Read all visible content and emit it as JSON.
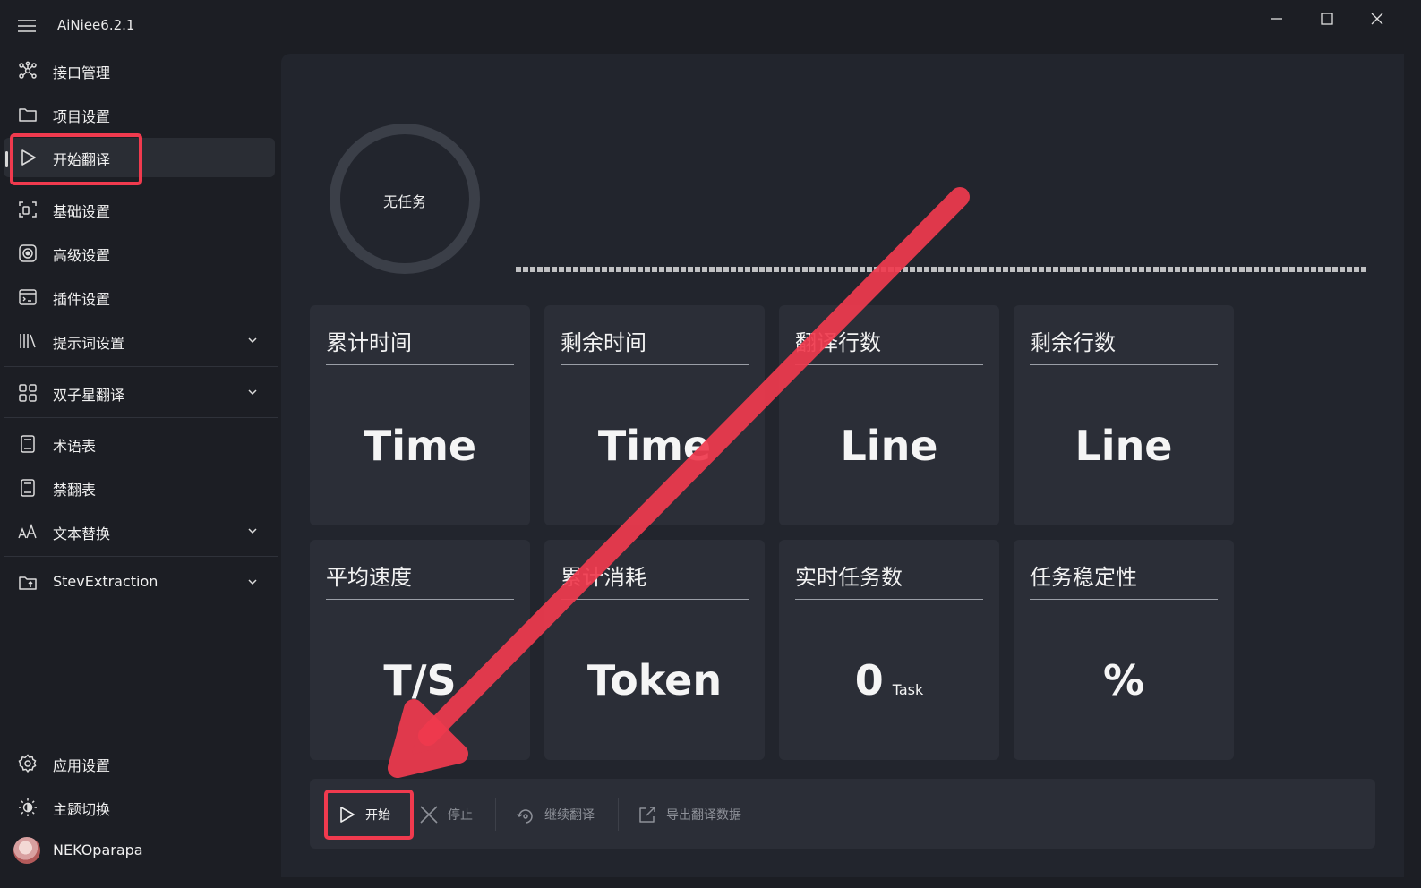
{
  "window": {
    "title": "AiNiee6.2.1"
  },
  "sidebar": {
    "items": [
      {
        "label": "接口管理"
      },
      {
        "label": "项目设置"
      },
      {
        "label": "开始翻译"
      },
      {
        "label": "基础设置"
      },
      {
        "label": "高级设置"
      },
      {
        "label": "插件设置"
      },
      {
        "label": "提示词设置"
      },
      {
        "label": "双子星翻译"
      },
      {
        "label": "术语表"
      },
      {
        "label": "禁翻表"
      },
      {
        "label": "文本替换"
      },
      {
        "label": "StevExtraction"
      },
      {
        "label": "应用设置"
      },
      {
        "label": "主题切换"
      },
      {
        "label": "NEKOparapa"
      }
    ],
    "active_index": 2
  },
  "status": {
    "ring_label": "无任务",
    "progress": 0
  },
  "cards": [
    {
      "title": "累计时间",
      "value": "Time"
    },
    {
      "title": "剩余时间",
      "value": "Time"
    },
    {
      "title": "翻译行数",
      "value": "Line"
    },
    {
      "title": "剩余行数",
      "value": "Line"
    },
    {
      "title": "平均速度",
      "value": "T/S"
    },
    {
      "title": "累计消耗",
      "value": "Token"
    },
    {
      "title": "实时任务数",
      "value": "0",
      "unit": "Task"
    },
    {
      "title": "任务稳定性",
      "value": "%"
    }
  ],
  "commands": {
    "start": "开始",
    "stop": "停止",
    "continue": "继续翻译",
    "export": "导出翻译数据"
  },
  "colors": {
    "highlight": "#f03a4e",
    "background": "#1c1e24",
    "card": "#2b2e37"
  }
}
